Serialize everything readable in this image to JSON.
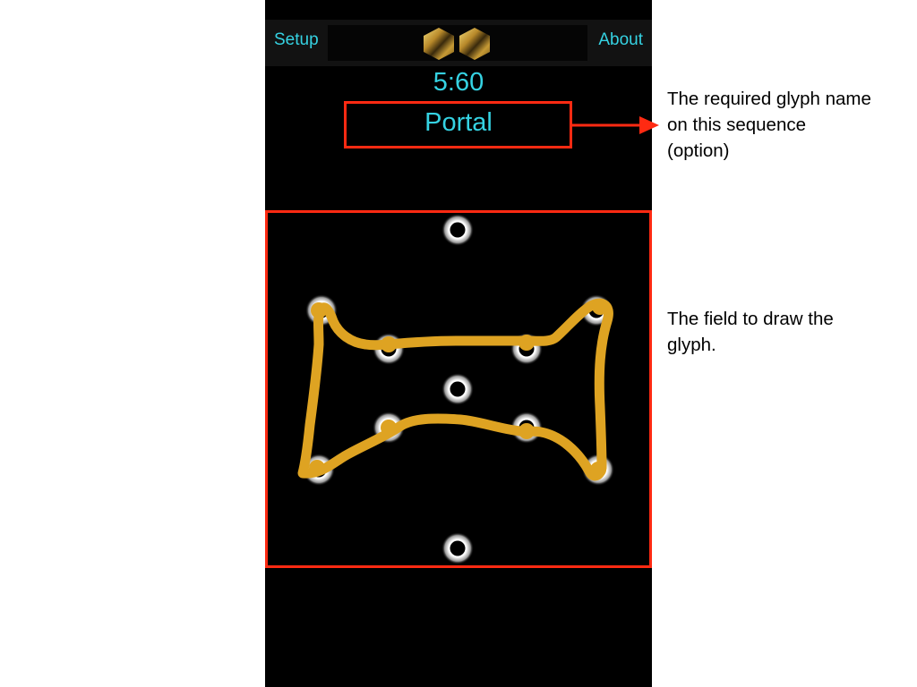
{
  "navbar": {
    "setup_label": "Setup",
    "about_label": "About",
    "logo_icon": "hexagon-pair-logo"
  },
  "timer": {
    "value": "5:60"
  },
  "glyph": {
    "name": "Portal",
    "stroke_color": "#dea322"
  },
  "annotations": {
    "glyph_name_note": [
      "The required glyph name",
      "on this sequence",
      "(option)"
    ],
    "field_note": [
      "The field to draw the",
      "glyph."
    ]
  },
  "colors": {
    "accent_text": "#35d2e2",
    "highlight_border": "#ff2a12",
    "background": "#000000"
  }
}
